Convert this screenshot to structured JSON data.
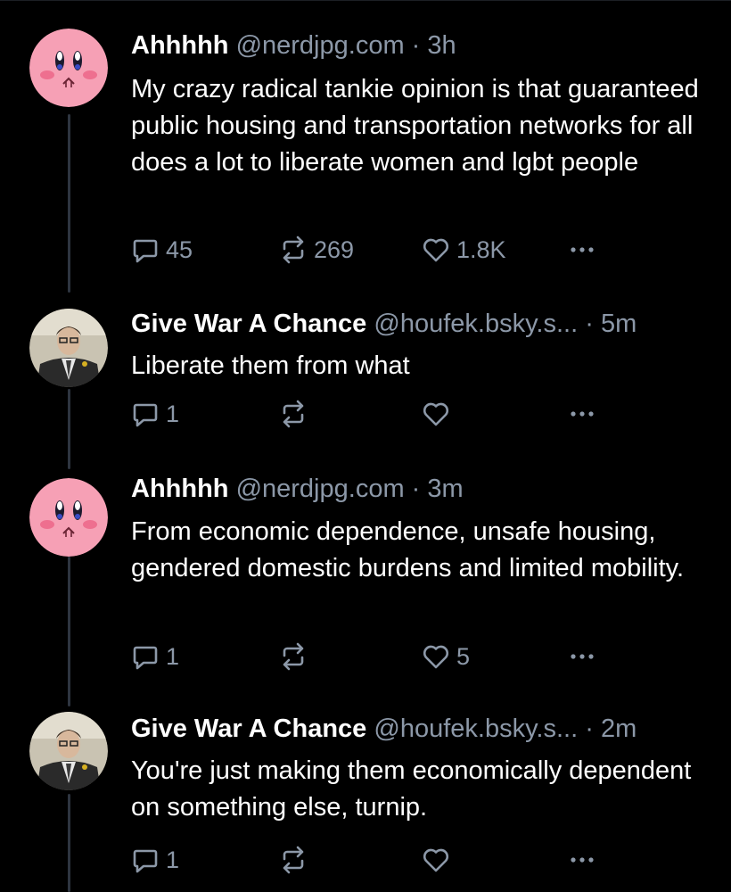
{
  "colors": {
    "background": "#000000",
    "text": "#ffffff",
    "muted": "#8c98a8",
    "thread_line": "#2e3540"
  },
  "posts": [
    {
      "display_name": "Ahhhhh",
      "handle": "@nerdjpg.com",
      "separator": "·",
      "time": "3h",
      "text": "My crazy radical tankie opinion is that guaranteed public housing and transportation networks for all does a lot to liberate women and lgbt people",
      "reply_count": "45",
      "repost_count": "269",
      "like_count": "1.8K",
      "avatar_icon": "kirby-avatar-icon"
    },
    {
      "display_name": "Give War A Chance",
      "handle": "@houfek.bsky.s...",
      "separator": "·",
      "time": "5m",
      "text": "Liberate them from what",
      "reply_count": "1",
      "repost_count": "",
      "like_count": "",
      "avatar_icon": "man-in-suit-avatar-icon"
    },
    {
      "display_name": "Ahhhhh",
      "handle": "@nerdjpg.com",
      "separator": "·",
      "time": "3m",
      "text": "From economic dependence, unsafe housing, gendered domestic burdens and limited mobility.",
      "reply_count": "1",
      "repost_count": "",
      "like_count": "5",
      "avatar_icon": "kirby-avatar-icon"
    },
    {
      "display_name": "Give War A Chance",
      "handle": "@houfek.bsky.s...",
      "separator": "·",
      "time": "2m",
      "text": "You're just making them economically dependent on something else, turnip.",
      "reply_count": "1",
      "repost_count": "",
      "like_count": "",
      "avatar_icon": "man-in-suit-avatar-icon"
    }
  ],
  "icons": {
    "reply": "reply-icon",
    "repost": "repost-icon",
    "like": "heart-icon",
    "more": "more-options-icon"
  }
}
